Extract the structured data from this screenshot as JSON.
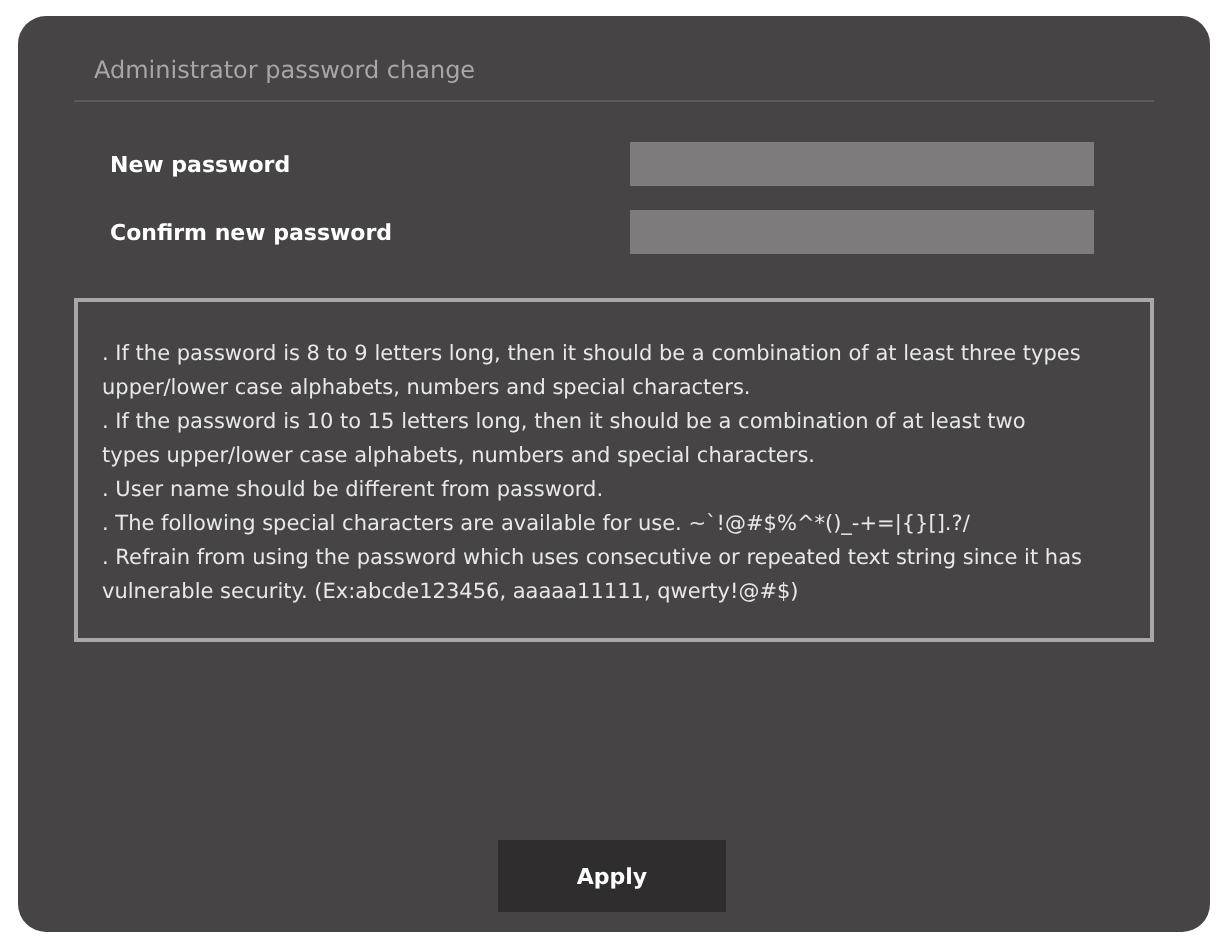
{
  "dialog": {
    "title": "Administrator password change"
  },
  "fields": [
    {
      "label": "New password"
    },
    {
      "label": "Confirm new password"
    }
  ],
  "notes": [
    ". If the password is 8 to 9 letters long, then it should be a combination of at least three types upper/lower case alphabets, numbers and special characters.",
    ". If the password is 10 to 15 letters long, then it should be a combination of at least two types upper/lower case alphabets, numbers and special characters.",
    ". User name should be different from password.",
    ". The following special characters are available for use. ~`!@#$%^*()_-+=|{}[].?/",
    ". Refrain from using the password which uses consecutive or repeated text string since it has vulnerable security. (Ex:abcde123456, aaaaa11111, qwerty!@#$)"
  ],
  "buttons": [
    "Apply"
  ]
}
